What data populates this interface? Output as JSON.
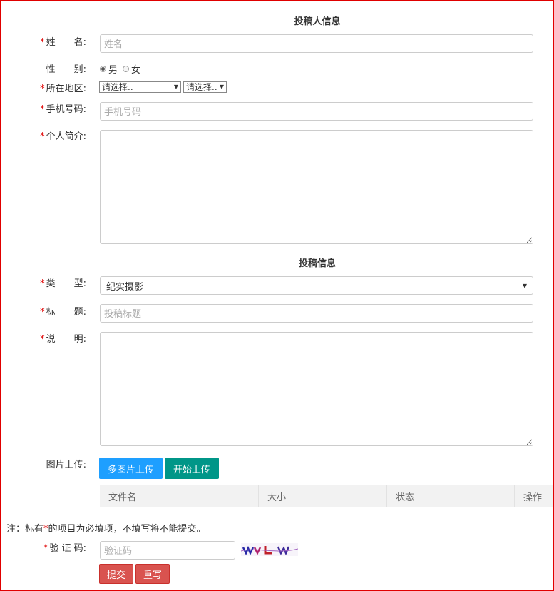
{
  "submitter_section": {
    "title": "投稿人信息"
  },
  "name": {
    "label": "姓　　名:",
    "placeholder": "姓名"
  },
  "gender": {
    "label": "性　　别:",
    "option_male": "男",
    "option_female": "女"
  },
  "region": {
    "label": "所在地区:",
    "select1": "请选择..",
    "select2": "请选择.."
  },
  "phone": {
    "label": "手机号码:",
    "placeholder": "手机号码"
  },
  "bio": {
    "label": "个人简介:"
  },
  "submission_section": {
    "title": "投稿信息"
  },
  "type": {
    "label": "类　　型:",
    "value": "纪实摄影"
  },
  "title_field": {
    "label": "标　　题:",
    "placeholder": "投稿标题"
  },
  "description": {
    "label": "说　　明:"
  },
  "upload": {
    "label": "图片上传:",
    "multi_button": "多图片上传",
    "start_button": "开始上传",
    "columns": [
      "文件名",
      "大小",
      "状态",
      "操作"
    ]
  },
  "note": {
    "prefix": "注：标有",
    "star": "*",
    "suffix": "的项目为必填项，不填写将不能提交。"
  },
  "captcha": {
    "label": "验 证 码:",
    "placeholder": "验证码",
    "image_text": "wvLw"
  },
  "actions": {
    "submit": "提交",
    "reset": "重写"
  },
  "colors": {
    "blue_button": "#1e9fff",
    "teal_button": "#009688",
    "red_button": "#d9534f",
    "required_star": "#e00000"
  }
}
